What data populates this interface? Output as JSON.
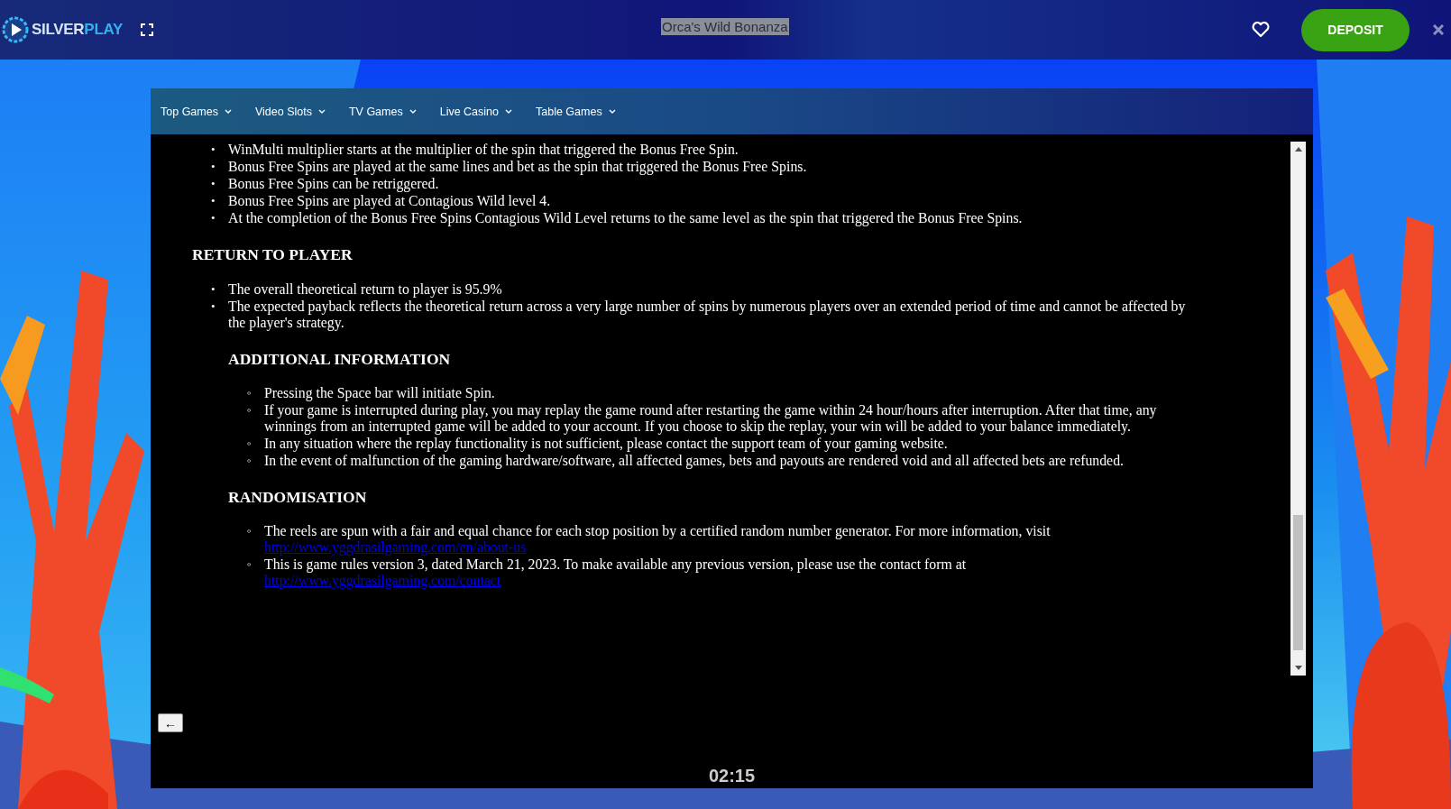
{
  "header": {
    "logo": {
      "part_1": "SILVER",
      "part_2": "PLAY"
    },
    "game_title": "Orca's Wild Bonanza",
    "deposit_button": "DEPOSIT"
  },
  "nav": [
    {
      "label": "Top Games"
    },
    {
      "label": "Video Slots"
    },
    {
      "label": "TV Games"
    },
    {
      "label": "Live Casino"
    },
    {
      "label": "Table Games"
    }
  ],
  "rules": [
    {
      "marker": "•",
      "items": [
        {
          "text": "WinMulti multiplier starts at the multiplier of the spin that triggered the Bonus Free Spin."
        },
        {
          "text": "Bonus Free Spins are played at the same lines and bet as the spin that triggered the Bonus Free Spins."
        },
        {
          "text": "Bonus Free Spins can be retriggered."
        },
        {
          "text": "Bonus Free Spins are played at Contagious Wild level 4."
        },
        {
          "text": "At the completion of the Bonus Free Spins Contagious Wild Level returns to the same level as the spin that triggered the Bonus Free Spins."
        }
      ]
    },
    {
      "heading": "RETURN TO PLAYER",
      "marker": "•",
      "items": [
        {
          "text": "The overall theoretical return to player is 95.9%"
        },
        {
          "text": "The expected payback reflects the theoretical return across a very large number of spins by numerous players over an extended period of time and cannot be affected by the player's strategy."
        }
      ],
      "children": [
        {
          "heading": "ADDITIONAL INFORMATION",
          "marker": "◦",
          "items": [
            {
              "text": "Pressing the Space bar will initiate Spin."
            },
            {
              "text": "If your game is interrupted during play, you may replay the game round after restarting the game within 24 hour/hours after interruption. After that time, any winnings from an interrupted game will be added to your account. If you choose to skip the replay, your win will be added to your balance immediately."
            },
            {
              "text": "In any situation where the replay functionality is not sufficient, please contact the support team of your gaming website."
            },
            {
              "text": "In the event of malfunction of the gaming hardware/software, all affected games, bets and payouts are rendered void and all affected bets are refunded."
            }
          ]
        },
        {
          "heading": "RANDOMISATION",
          "marker": "◦",
          "items": [
            {
              "text": "The reels are spun with a fair and equal chance for each stop position by a certified random number generator. For more information, visit",
              "link": "http://www.yggdrasilgaming.com/en/about-us"
            },
            {
              "text": "This is game rules version 3, dated March 21, 2023. To make available any previous version, please use the contact form at",
              "link": "http://www.yggdrasilgaming.com/contact"
            }
          ]
        }
      ]
    }
  ],
  "back_button": "←",
  "timer": "02:15"
}
